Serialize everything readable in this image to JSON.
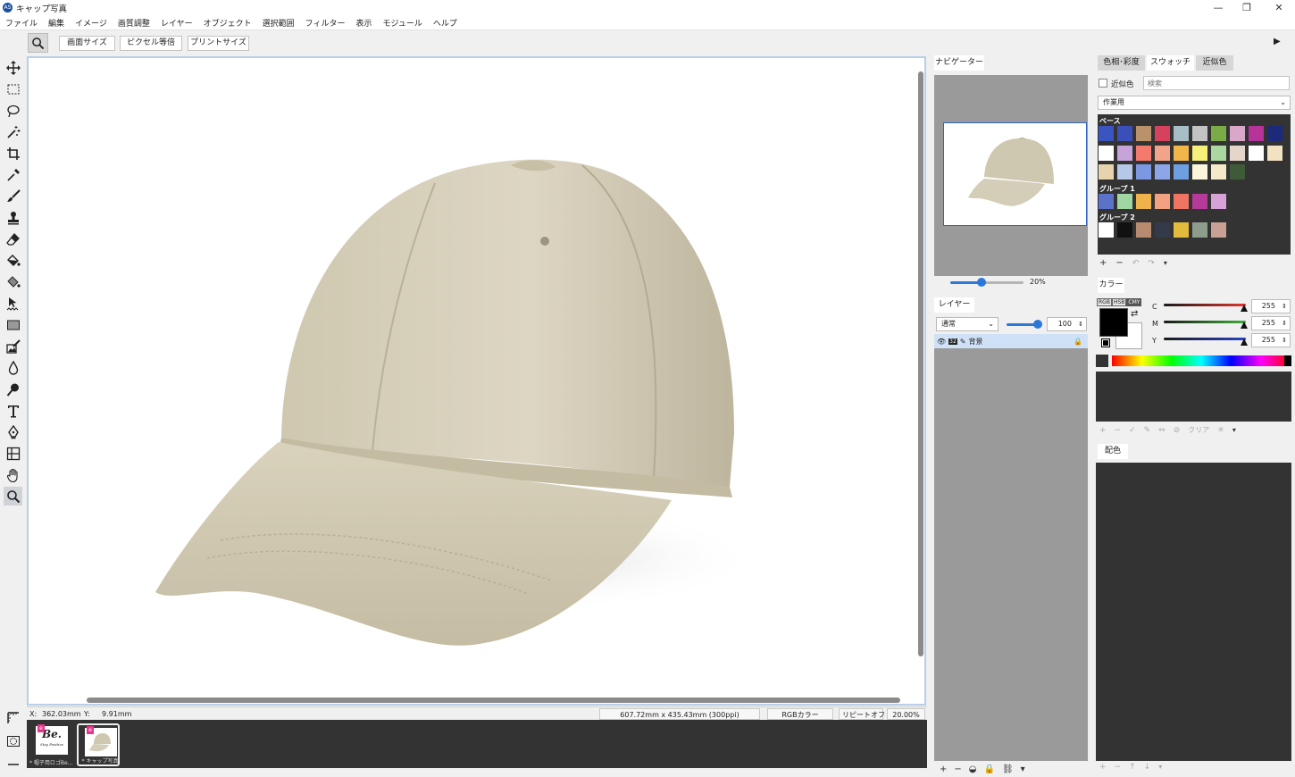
{
  "window": {
    "title": "キャップ写真",
    "logo": "AS",
    "minimize": "—",
    "restore": "❐",
    "close": "✕"
  },
  "menu": [
    "ファイル",
    "編集",
    "イメージ",
    "画質調整",
    "レイヤー",
    "オブジェクト",
    "選択範囲",
    "フィルター",
    "表示",
    "モジュール",
    "ヘルプ"
  ],
  "options": {
    "fit_screen": "画面サイズ",
    "pixel_equal": "ピクセル等倍",
    "print_size": "プリントサイズ",
    "expand_arrow": "▶"
  },
  "status": {
    "x_label": "X:",
    "x_value": "362.03mm",
    "y_label": "Y:",
    "y_value": "9.91mm",
    "doc_size": "607.72mm x 435.43mm (300ppi)",
    "color_mode": "RGBカラー",
    "repeat": "リピートオフ",
    "zoom": "20.00%"
  },
  "thumbnails": [
    {
      "caption": "* 帽子用ロゴBe...",
      "logo_text": "Be.",
      "logo_sub": "Stay Positive",
      "badge": "e"
    },
    {
      "caption": "* キャップ写真",
      "badge": "e"
    }
  ],
  "navigator": {
    "tab": "ナビゲーター",
    "zoom_percent": "20%",
    "zoom_level": 0.2
  },
  "layers": {
    "tab": "レイヤー",
    "blend_mode": "通常",
    "opacity": "100",
    "opacity_level": 1.0,
    "row": {
      "name": "背景",
      "bit": "32"
    }
  },
  "color_tabs": {
    "hue": "色相･彩度",
    "swatch": "スウォッチ",
    "similar": "近似色"
  },
  "similar": {
    "checkbox_label": "近似色",
    "search_placeholder": "検索"
  },
  "swatch_set": "作業用",
  "swatch_groups": [
    {
      "label": "ベース",
      "rows": [
        [
          "#3b55c0",
          "#3b4fb8",
          "#b9916a",
          "#d6425e",
          "#a9bdc6",
          "#c3c3c3",
          "#7bab47",
          "#d9a8c9",
          "#b6349a",
          "#1d2a7c"
        ],
        [
          "#ffffff",
          "#c6a3d8",
          "#f47a6e",
          "#f2a48a",
          "#f1b64a",
          "#f6f07a",
          "#a9d8a0",
          "#e6d5c9",
          "#ffffff",
          "#f1e2c2"
        ],
        [
          "#e7d4ad",
          "#b5c8e8",
          "#7c98e2",
          "#8ea6e8",
          "#6e9fe0",
          "#fbf6db",
          "#f4e9c8",
          "#3f5a38"
        ]
      ]
    },
    {
      "label": "グループ 1",
      "rows": [
        [
          "#5b72c9",
          "#9fd6a1",
          "#f0b34c",
          "#f2a280",
          "#f07462",
          "#b63a9a",
          "#d6a2d8"
        ]
      ]
    },
    {
      "label": "グループ 2",
      "rows": [
        [
          "#ffffff",
          "#111111",
          "#b88a70",
          "#333a4a",
          "#e2bb3c",
          "#8e9c8c",
          "#c9a094"
        ]
      ]
    }
  ],
  "color_panel": {
    "title": "カラー",
    "modes": [
      "RGB",
      "HSB",
      "CMY"
    ],
    "channels": [
      {
        "name": "C",
        "value": "255",
        "color": "#e3342b"
      },
      {
        "name": "M",
        "value": "255",
        "color": "#3fae3a"
      },
      {
        "name": "Y",
        "value": "255",
        "color": "#2b44c8"
      }
    ],
    "foreground": "#000000",
    "background": "#ffffff"
  },
  "color_list_toolbar": {
    "clear": "クリア"
  },
  "palette_panel": {
    "title": "配色"
  }
}
